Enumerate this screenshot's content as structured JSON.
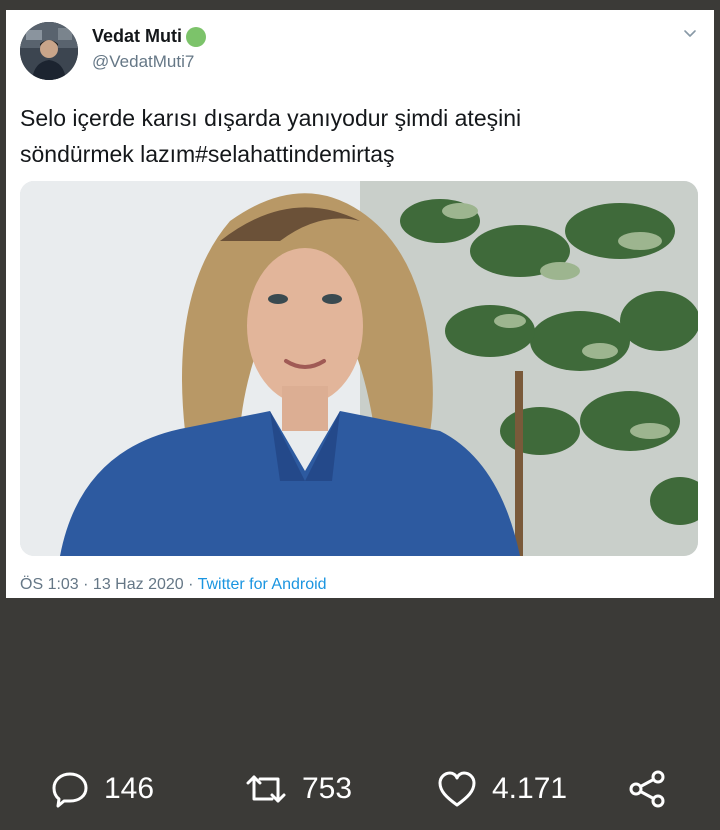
{
  "tweet": {
    "author": {
      "name": "Vedat Muti",
      "handle": "@VedatMuti7"
    },
    "text_line1": "Selo içerde karısı dışarda yanıyodur şimdi ateşini",
    "text_line2": "söndürmek lazım#selahattindemirtaş",
    "meta": {
      "time": "ÖS 1:03",
      "sep1": " · ",
      "date": "13 Haz 2020",
      "sep2": " · ",
      "source": "Twitter for Android"
    }
  },
  "actions": {
    "comments": "146",
    "retweets": "753",
    "likes": "4.171"
  },
  "colors": {
    "background": "#3b3a37",
    "card": "#ffffff",
    "link": "#1b95e0",
    "muted": "#657786",
    "verified": "#7cc36a"
  }
}
